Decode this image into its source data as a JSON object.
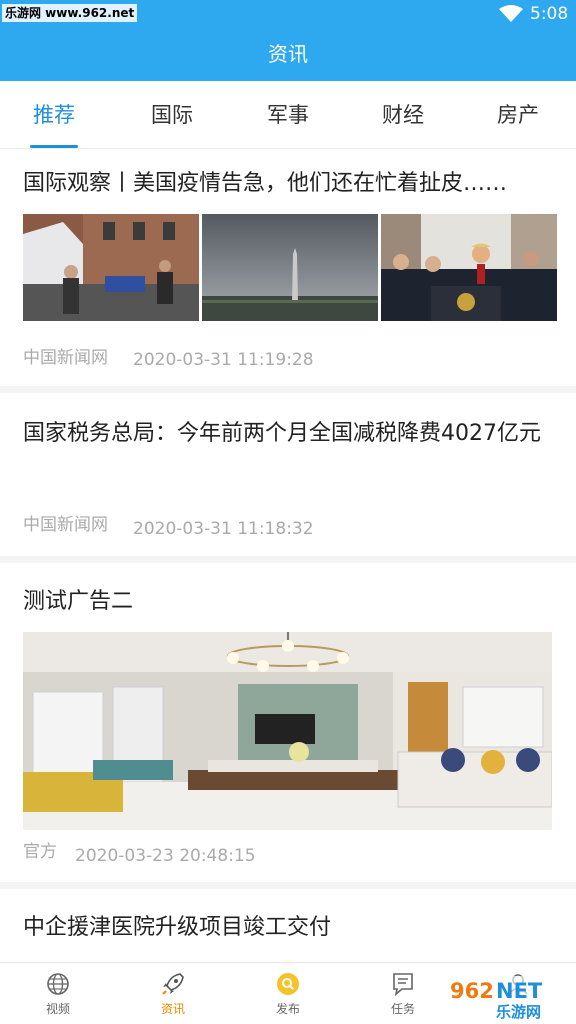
{
  "status_bar": {
    "watermark": "乐游网 www.962.net",
    "time": "5:08"
  },
  "header": {
    "title": "资讯"
  },
  "tabs": [
    {
      "label": "推荐",
      "active": true
    },
    {
      "label": "国际",
      "active": false
    },
    {
      "label": "军事",
      "active": false
    },
    {
      "label": "财经",
      "active": false
    },
    {
      "label": "房产",
      "active": false
    }
  ],
  "articles": [
    {
      "title": "国际观察丨美国疫情告急，他们还在忙着扯皮……",
      "source": "中国新闻网",
      "time": "2020-03-31 11:19:28"
    },
    {
      "title": "国家税务总局：今年前两个月全国减税降费4027亿元",
      "source": "中国新闻网",
      "time": "2020-03-31 11:18:32"
    },
    {
      "title": "测试广告二",
      "source": "官方",
      "time": "2020-03-23 20:48:15"
    },
    {
      "title": "中企援津医院升级项目竣工交付"
    }
  ],
  "bottom_nav": [
    {
      "label": "视频",
      "icon": "video-globe-icon",
      "active": false
    },
    {
      "label": "资讯",
      "icon": "rocket-icon",
      "active": true
    },
    {
      "label": "发布",
      "icon": "search-circle-icon",
      "active": false
    },
    {
      "label": "任务",
      "icon": "task-icon",
      "active": false
    },
    {
      "label": "",
      "icon": "profile-icon",
      "active": false
    }
  ],
  "watermark_bottom": {
    "brand": "962NET",
    "name": "乐游网"
  },
  "colors": {
    "accent": "#2ea8ee",
    "tab_active": "#1f8fdc",
    "nav_active": "#f08a00"
  }
}
